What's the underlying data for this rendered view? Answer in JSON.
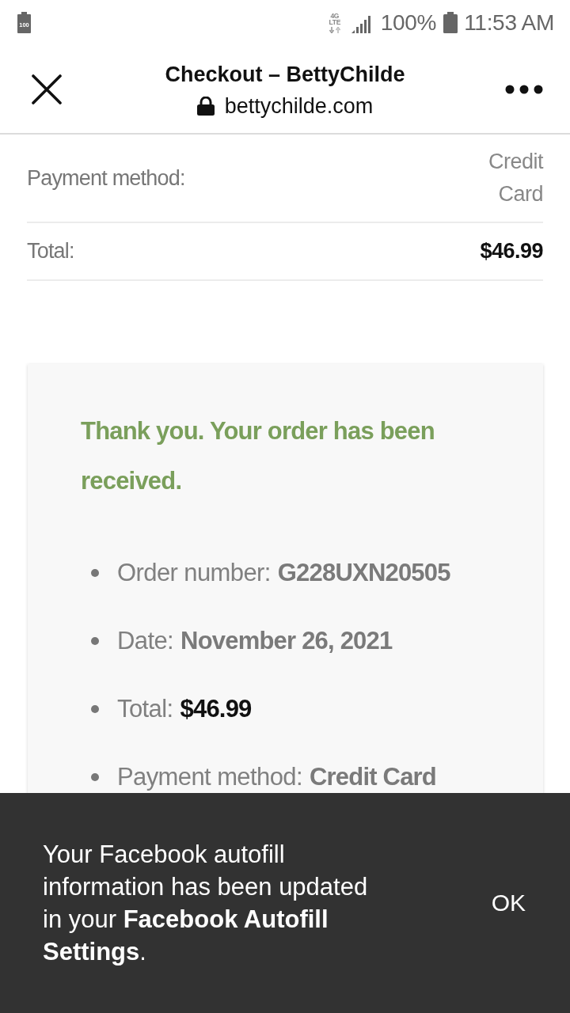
{
  "status_bar": {
    "notification_badge": "100",
    "network_type": "4G LTE",
    "battery_percent": "100%",
    "time": "11:53 AM"
  },
  "browser_header": {
    "title": "Checkout – BettyChilde",
    "domain": "bettychilde.com"
  },
  "summary_rows": [
    {
      "label": "Payment method:",
      "value": "Credit Card",
      "kind": "text"
    },
    {
      "label": "Total:",
      "value": "$46.99",
      "kind": "amount"
    }
  ],
  "order_card": {
    "message": "Thank you. Your order has been received.",
    "details": [
      {
        "label": "Order number:",
        "value": "G228UXN20505",
        "kind": "text"
      },
      {
        "label": "Date:",
        "value": "November 26, 2021",
        "kind": "text"
      },
      {
        "label": "Total:",
        "value": "$46.99",
        "kind": "amount"
      },
      {
        "label": "Payment method:",
        "value": "Credit Card",
        "kind": "text"
      }
    ]
  },
  "snackbar": {
    "message": "Your Facebook autofill information has been updated in your **Facebook Autofill Settings**.",
    "action": "OK"
  }
}
